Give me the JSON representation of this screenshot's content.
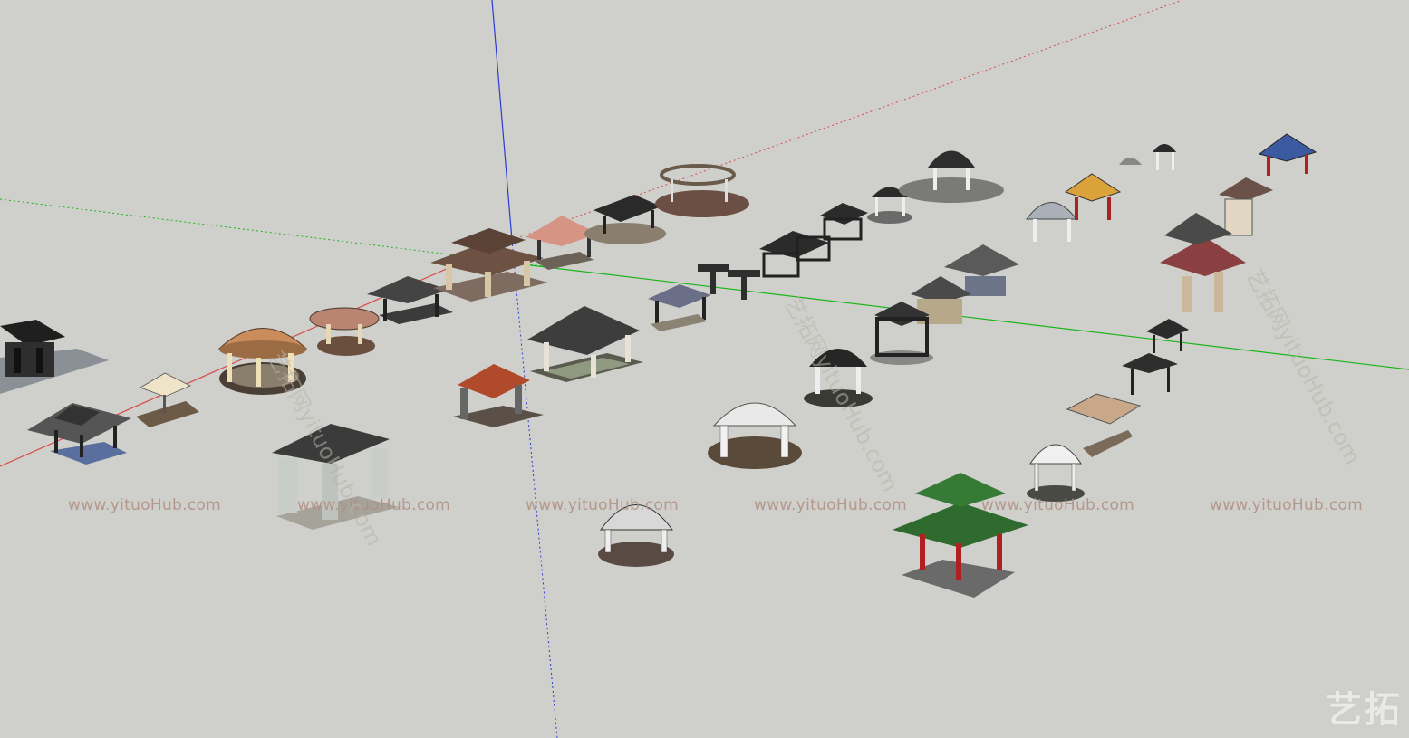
{
  "viewport": {
    "background": "#cfcfcb",
    "axis_colors": {
      "red": "#d84a4a",
      "green": "#19b519",
      "blue": "#2b3bd6"
    }
  },
  "watermark": {
    "url_text": "www.yituoHub.com",
    "diagonal_text": "艺拓网yituoHub.com",
    "logo_text": "艺拓",
    "color": "#b08f80"
  },
  "models": [
    "pavilion-model",
    "pavilion-model",
    "pavilion-model",
    "pavilion-model",
    "pavilion-model"
  ]
}
